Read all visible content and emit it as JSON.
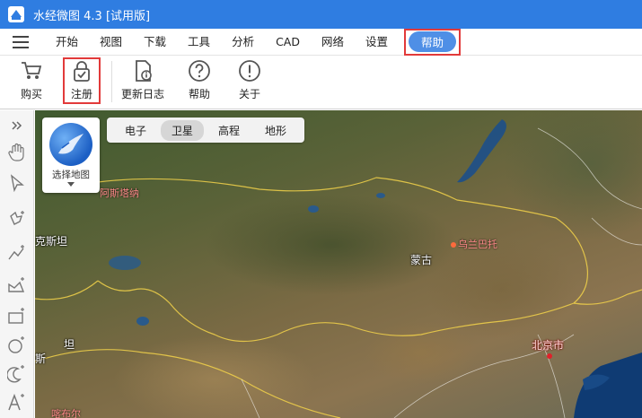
{
  "app": {
    "title": "水经微图 4.3 [试用版]"
  },
  "menu": {
    "items": [
      "开始",
      "视图",
      "下载",
      "工具",
      "分析",
      "CAD",
      "网络",
      "设置"
    ],
    "active": "帮助"
  },
  "toolbar": {
    "buy": "购买",
    "register": "注册",
    "changelog": "更新日志",
    "help": "帮助",
    "about": "关于"
  },
  "map": {
    "picker_label": "选择地图",
    "layers": [
      "电子",
      "卫星",
      "高程",
      "地形"
    ],
    "active_layer": "卫星",
    "places": {
      "almaty": "阿斯塔纳",
      "kazakh": "克斯坦",
      "kazakh2": "坦",
      "mongolia": "蒙古",
      "ulaanbaatar": "乌兰巴托",
      "beijing": "北京市",
      "edge1": "斯",
      "edge2": "喀布尔"
    }
  },
  "colors": {
    "titlebar": "#2f7de1",
    "highlight": "#e23a3a",
    "help_active": "#4f8fe6"
  }
}
